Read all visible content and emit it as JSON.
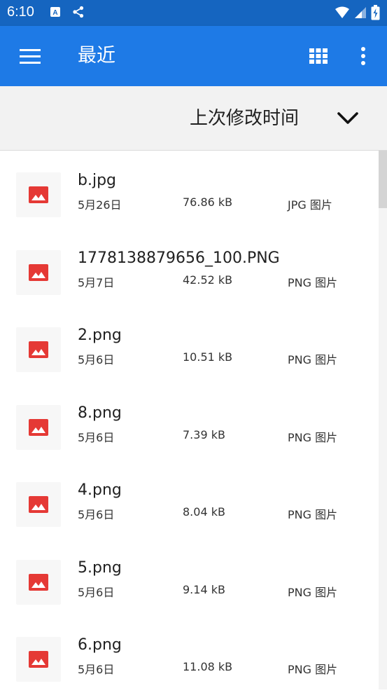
{
  "status_bar": {
    "time": "6:10",
    "left_icons": [
      "a-icon",
      "share-icon"
    ],
    "right_icons": [
      "wifi-icon",
      "signal-icon",
      "battery-icon"
    ]
  },
  "app_bar": {
    "title": "最近",
    "color": "#1e7ae6"
  },
  "sort": {
    "label": "上次修改时间"
  },
  "files": [
    {
      "name": "b.jpg",
      "date": "5月26日",
      "size": "76.86 kB",
      "type": "JPG 图片"
    },
    {
      "name": "1778138879656_100.PNG",
      "date": "5月7日",
      "size": "42.52 kB",
      "type": "PNG 图片"
    },
    {
      "name": "2.png",
      "date": "5月6日",
      "size": "10.51 kB",
      "type": "PNG 图片"
    },
    {
      "name": "8.png",
      "date": "5月6日",
      "size": "7.39 kB",
      "type": "PNG 图片"
    },
    {
      "name": "4.png",
      "date": "5月6日",
      "size": "8.04 kB",
      "type": "PNG 图片"
    },
    {
      "name": "5.png",
      "date": "5月6日",
      "size": "9.14 kB",
      "type": "PNG 图片"
    },
    {
      "name": "6.png",
      "date": "5月6日",
      "size": "11.08 kB",
      "type": "PNG 图片"
    }
  ],
  "colors": {
    "status_bar": "#1565c0",
    "image_icon": "#e53935"
  }
}
